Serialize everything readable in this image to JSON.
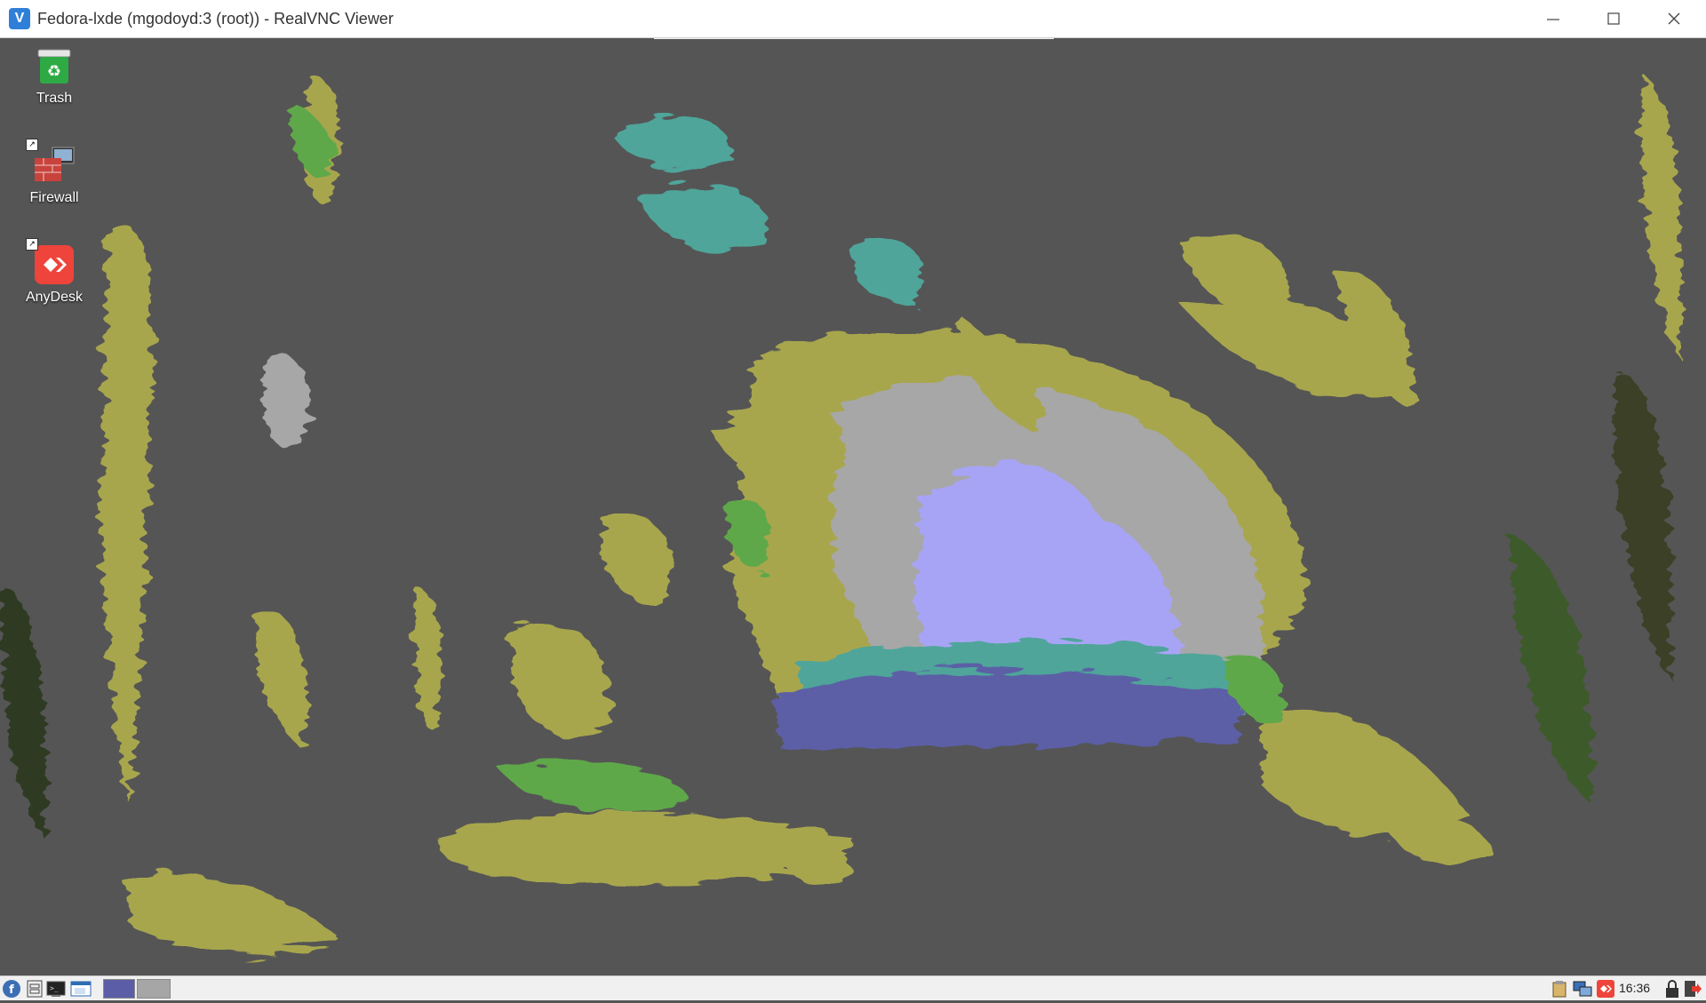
{
  "window": {
    "title": "Fedora-lxde (mgodoyd:3 (root)) - RealVNC Viewer",
    "app_icon": "realvnc-icon",
    "controls": [
      "minimize-icon",
      "maximize-icon",
      "close-icon"
    ]
  },
  "desktop": {
    "icons": [
      {
        "label": "Trash",
        "icon": "trash-icon"
      },
      {
        "label": "Firewall",
        "icon": "firewall-icon"
      },
      {
        "label": "AnyDesk",
        "icon": "anydesk-icon"
      }
    ]
  },
  "taskbar": {
    "launchers": [
      "fedora-menu-icon",
      "file-manager-icon",
      "terminal-icon",
      "show-desktop-icon"
    ],
    "workspaces": [
      {
        "active": true,
        "color": "#5b5ea6"
      },
      {
        "active": false,
        "color": "#a6a6a6"
      }
    ],
    "tray": [
      "clipboard-icon",
      "network-icon",
      "anydesk-tray-icon",
      "lock-icon",
      "logout-icon"
    ],
    "clock": "16:36"
  },
  "colors": {
    "desktop_bg": "#555555",
    "accent_yellow": "#a8a64e",
    "accent_green": "#5fa84a",
    "accent_teal": "#4fa59a",
    "accent_lavender": "#a7a4f5",
    "accent_indigo": "#5b5ea6",
    "anydesk_red": "#ef443b"
  }
}
